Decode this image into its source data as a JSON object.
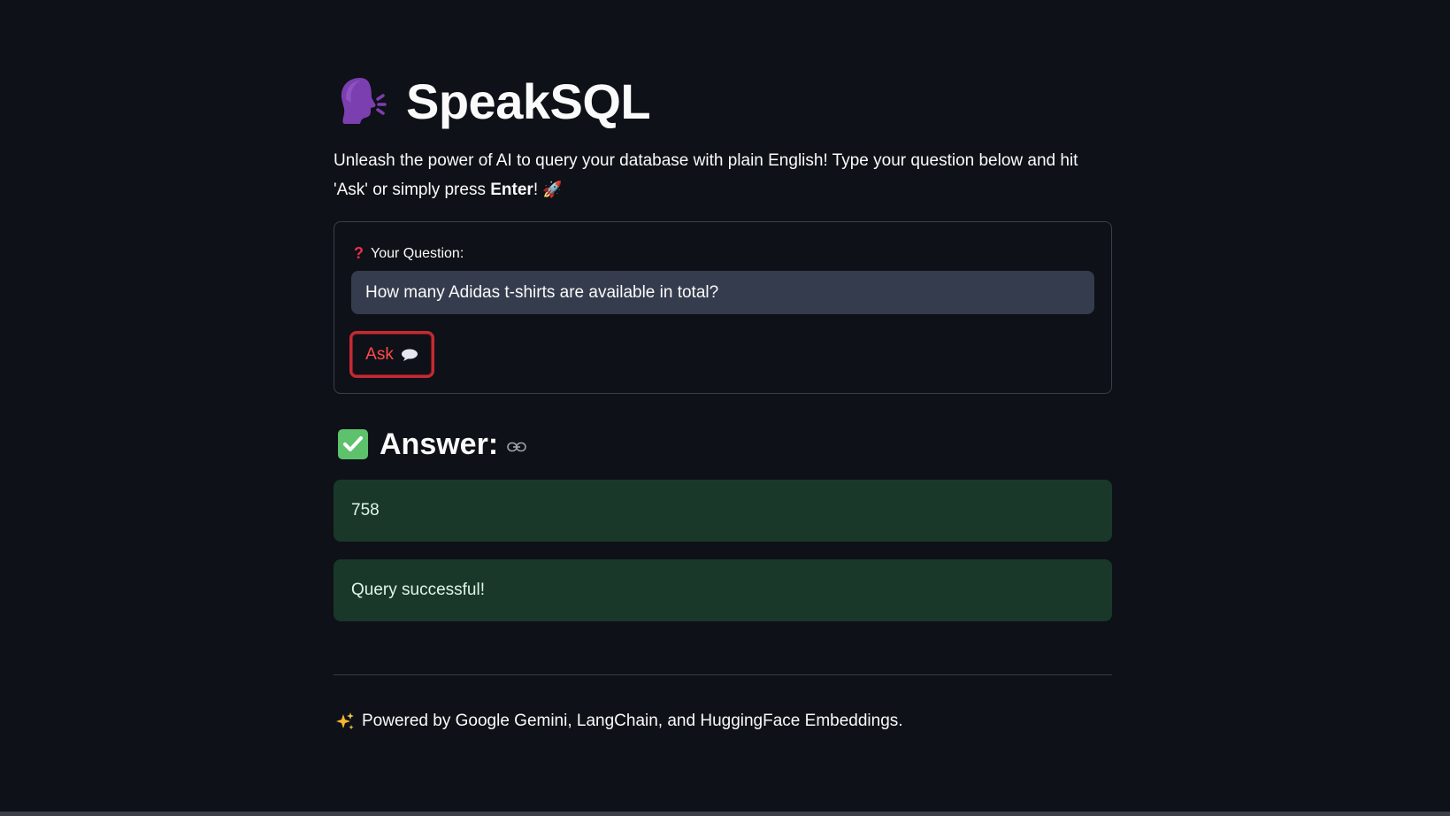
{
  "app": {
    "title": "SpeakSQL",
    "title_icon": "speaking-head-icon"
  },
  "intro": {
    "text_before": "Unleash the power of AI to query your database with plain English! Type your question below and hit 'Ask' or simply press ",
    "bold": "Enter",
    "text_after": "! ",
    "icon": "rocket-icon"
  },
  "form": {
    "label": "Your Question:",
    "label_icon": "red-question-mark-icon",
    "input_value": "How many Adidas t-shirts are available in total?",
    "ask_label": "Ask",
    "ask_icon": "speech-bubble-icon"
  },
  "answer": {
    "heading": "Answer:",
    "heading_icon": "check-mark-icon",
    "value": "758",
    "status": "Query successful!"
  },
  "footer": {
    "text": "Powered by Google Gemini, LangChain, and HuggingFace Embeddings.",
    "icon": "sparkles-icon"
  },
  "colors": {
    "background": "#0e1117",
    "accent": "#ff4b4b",
    "success_bg": "#1a3829",
    "input_bg": "#353c4d"
  }
}
